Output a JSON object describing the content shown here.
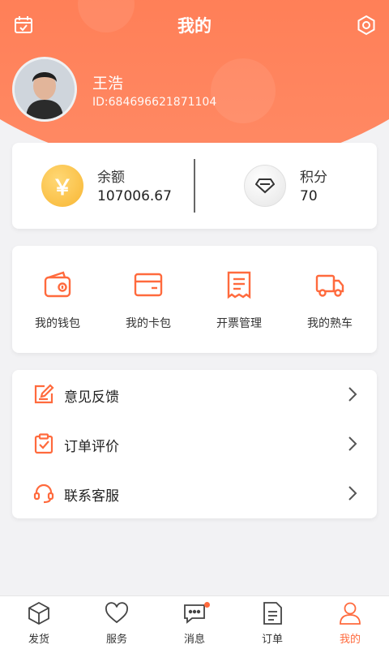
{
  "header": {
    "title": "我的"
  },
  "user": {
    "name": "王浩",
    "id_text": "ID:684696621871104"
  },
  "balance": {
    "label": "余额",
    "value": "107006.67",
    "coin_symbol": "￥"
  },
  "points": {
    "label": "积分",
    "value": "70"
  },
  "functions": [
    {
      "label": "我的钱包",
      "icon": "wallet-icon"
    },
    {
      "label": "我的卡包",
      "icon": "card-icon"
    },
    {
      "label": "开票管理",
      "icon": "invoice-icon"
    },
    {
      "label": "我的熟车",
      "icon": "truck-icon"
    }
  ],
  "menu": [
    {
      "label": "意见反馈",
      "icon": "feedback-icon"
    },
    {
      "label": "订单评价",
      "icon": "clipboard-check-icon"
    },
    {
      "label": "联系客服",
      "icon": "headset-icon"
    }
  ],
  "tabs": [
    {
      "label": "发货",
      "icon": "cube-icon",
      "active": false
    },
    {
      "label": "服务",
      "icon": "heart-icon",
      "active": false
    },
    {
      "label": "消息",
      "icon": "chat-icon",
      "active": false,
      "badge": true
    },
    {
      "label": "订单",
      "icon": "document-icon",
      "active": false
    },
    {
      "label": "我的",
      "icon": "user-icon",
      "active": true
    }
  ],
  "colors": {
    "accent": "#ff6a3d",
    "coin": "#f8b633"
  }
}
